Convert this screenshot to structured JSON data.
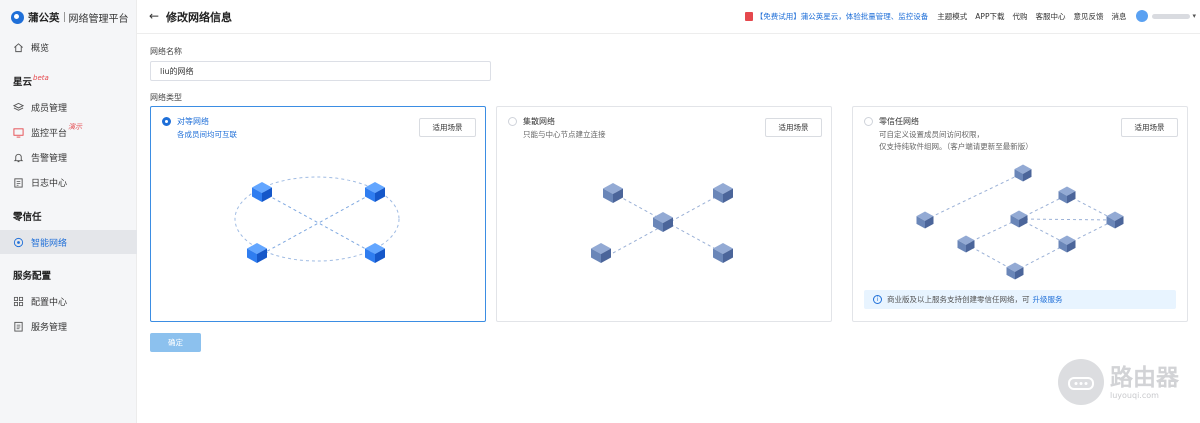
{
  "brand": {
    "name": "蒲公英",
    "subtitle": "网络管理平台"
  },
  "sidebar": {
    "items": [
      {
        "label": "概览",
        "icon": "home-icon"
      },
      {
        "label": "成员管理",
        "icon": "layers-icon"
      },
      {
        "label": "监控平台",
        "icon": "monitor-icon",
        "tag": "演示"
      },
      {
        "label": "告警管理",
        "icon": "bell-icon"
      },
      {
        "label": "日志中心",
        "icon": "clipboard-icon"
      },
      {
        "label": "智能网络",
        "icon": "network-icon",
        "active": true
      },
      {
        "label": "配置中心",
        "icon": "grid-icon"
      },
      {
        "label": "服务管理",
        "icon": "document-icon"
      }
    ],
    "groups": [
      {
        "label": "星云",
        "tag": "beta"
      },
      {
        "label": "零信任"
      },
      {
        "label": "服务配置"
      }
    ]
  },
  "header": {
    "back_icon": "arrow-left-icon",
    "title": "修改网络信息",
    "promo": "【免费试用】蒲公英星云，体验批量管理、监控设备",
    "links": [
      "主题模式",
      "APP下载",
      "代购",
      "客服中心",
      "意见反馈",
      "消息"
    ]
  },
  "form": {
    "name_label": "网络名称",
    "name_value": "liu的网络",
    "type_label": "网络类型",
    "confirm_label": "确定"
  },
  "cards": [
    {
      "title": "对等网络",
      "desc": [
        "各成员间均可互联"
      ],
      "button": "适用场景",
      "selected": true
    },
    {
      "title": "集散网络",
      "desc": [
        "只能与中心节点建立连接"
      ],
      "button": "适用场景",
      "selected": false
    },
    {
      "title": "零信任网络",
      "desc": [
        "可自定义设置成员间访问权限，",
        "仅支持纯软件组网。（客户端请更新至最新版）"
      ],
      "button": "适用场景",
      "selected": false
    }
  ],
  "notice": {
    "text": "商业版及以上服务支持创建零信任网络，可",
    "link": "升级服务"
  },
  "watermark": {
    "big": "路由器",
    "small": "luyouqi.com"
  },
  "colors": {
    "accent": "#1f6fd8",
    "node_blue": "#1e73e8",
    "node_grey": "#5f7fb5",
    "confirm_disabled": "#8cc1ee"
  }
}
